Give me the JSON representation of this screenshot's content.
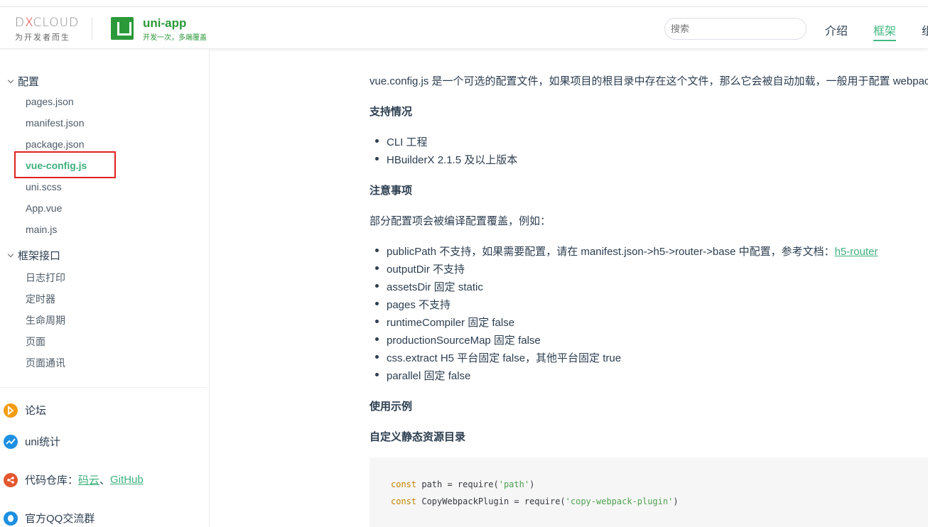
{
  "header": {
    "dcloud_logo_text": "DCLOUD",
    "dcloud_tagline": "为开发者而生",
    "product_name": "uni-app",
    "product_tagline": "开发一次，多端覆盖",
    "search_placeholder": "搜索",
    "nav": [
      {
        "label": "介绍"
      },
      {
        "label": "框架"
      },
      {
        "label": "组"
      }
    ]
  },
  "sidebar": {
    "group_config": "配置",
    "config_items": [
      "pages.json",
      "manifest.json",
      "package.json",
      "vue-config.js",
      "uni.scss",
      "App.vue",
      "main.js"
    ],
    "group_api": "框架接口",
    "api_items": [
      "日志打印",
      "定时器",
      "生命周期",
      "页面",
      "页面通讯"
    ],
    "links": {
      "forum": "论坛",
      "stats": "uni统计",
      "repo_label": "代码仓库：",
      "repo_gitee": "码云",
      "repo_sep": "、",
      "repo_github": "GitHub",
      "qq": "官方QQ交流群"
    }
  },
  "content": {
    "intro": "vue.config.js 是一个可选的配置文件，如果项目的根目录中存在这个文件，那么它会被自动加载，一般用于配置 webpack",
    "support_heading": "支持情况",
    "support_items": [
      "CLI 工程",
      "HBuilderX 2.1.5 及以上版本"
    ],
    "notes_heading": "注意事项",
    "notes_intro": "部分配置项会被编译配置覆盖，例如：",
    "note_first_text": "publicPath 不支持，如果需要配置，请在 manifest.json->h5->router->base 中配置，参考文档：",
    "note_first_link": "h5-router",
    "note_items": [
      "outputDir 不支持",
      "assetsDir 固定 static",
      "pages 不支持",
      "runtimeCompiler 固定 false",
      "productionSourceMap 固定 false",
      "css.extract H5 平台固定 false，其他平台固定 true",
      "parallel 固定 false"
    ],
    "usage_heading": "使用示例",
    "static_heading": "自定义静态资源目录",
    "code": {
      "line1_kw": "const",
      "line1_mid": " path = require(",
      "line1_str": "'path'",
      "line1_end": ")",
      "line2_kw": "const",
      "line2_mid": " CopyWebpackPlugin = require(",
      "line2_str": "'copy-webpack-plugin'",
      "line2_end": ")"
    }
  },
  "colors": {
    "accent": "#42b983",
    "uni_green": "#2b9939",
    "highlight_red": "#e02020"
  }
}
